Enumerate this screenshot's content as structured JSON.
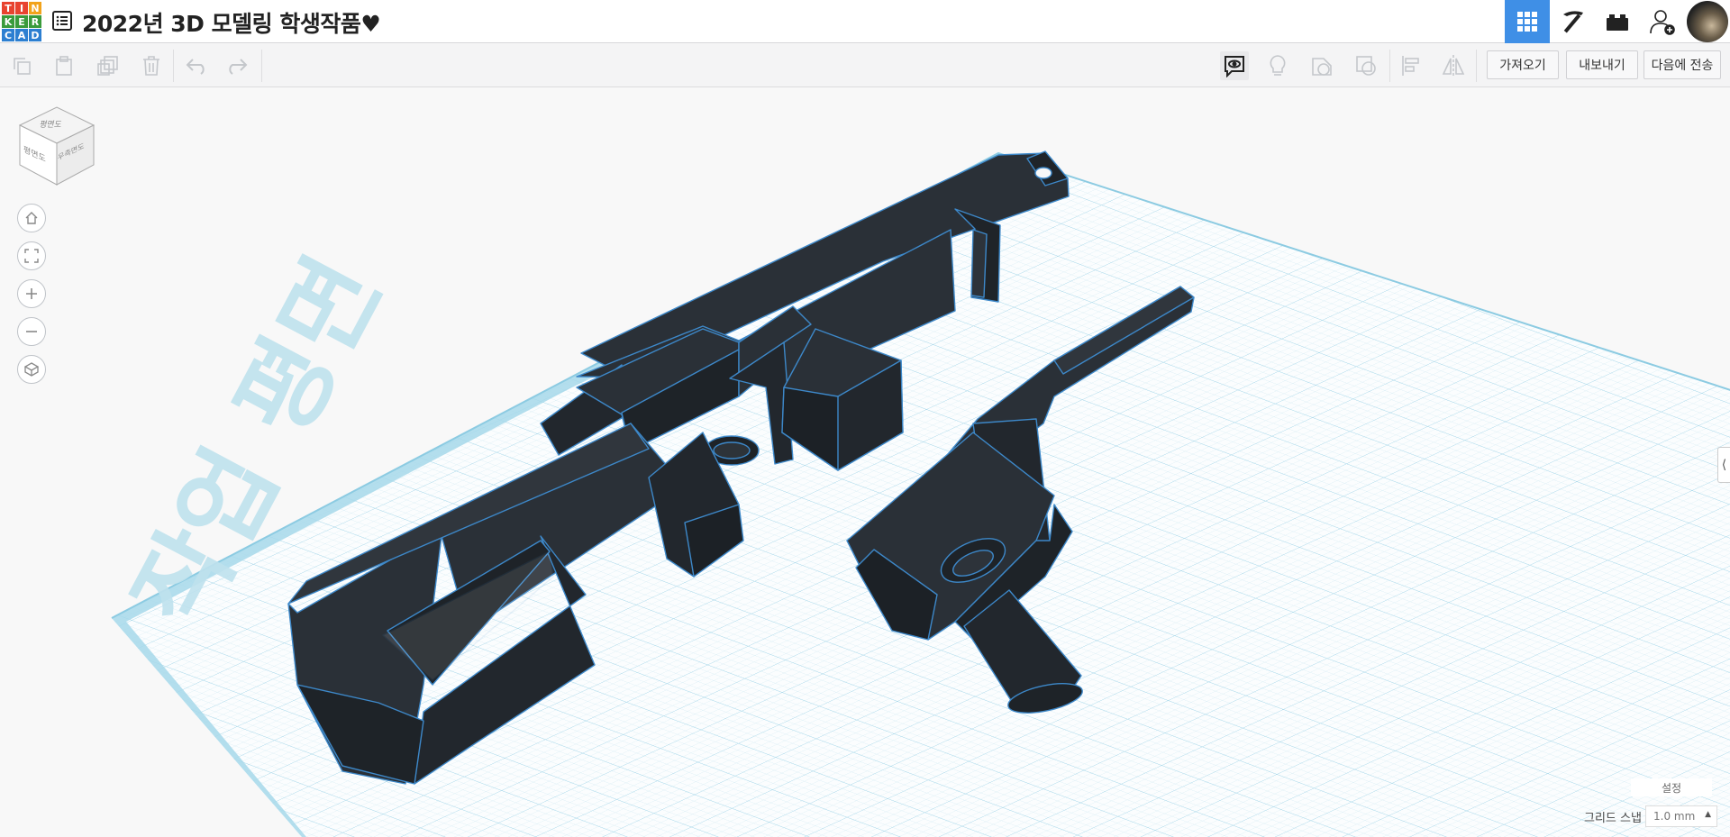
{
  "app": {
    "logo_letters": [
      "T",
      "I",
      "N",
      "K",
      "E",
      "R",
      "C",
      "A",
      "D"
    ],
    "logo_colors": [
      "#e8432f",
      "#e8432f",
      "#f2a31b",
      "#3a9b3b",
      "#3a9b3b",
      "#3a9b3b",
      "#2c7fd1",
      "#2c7fd1",
      "#2c7fd1"
    ],
    "title": "2022년 3D 모델링 학생작품♥",
    "accent": "#3f8fe6"
  },
  "header_icons": [
    "grid-view-icon",
    "pickaxe-icon",
    "bricks-icon",
    "add-user-icon",
    "profile-avatar"
  ],
  "toolbar": {
    "left_icons": [
      "copy-icon",
      "paste-icon",
      "duplicate-icon",
      "delete-icon",
      "undo-icon",
      "redo-icon"
    ],
    "right_icons": [
      "notes-icon",
      "light-bulb-icon",
      "shape-solid-icon",
      "shape-hole-icon",
      "align-icon",
      "mirror-icon"
    ],
    "import_label": "가져오기",
    "export_label": "내보내기",
    "send_to_label": "다음에 전송"
  },
  "viewcube": {
    "top_label": "평면도",
    "front_label": "평면도",
    "right_label": "우측면도"
  },
  "nav_icons": [
    "home-view-icon",
    "fit-view-icon",
    "zoom-in-icon",
    "zoom-out-icon",
    "perspective-icon"
  ],
  "workplane": {
    "watermark_text": "작업 평면",
    "grid_color": "#bfe4f0",
    "object_color": "#252a30",
    "edge_color": "#3d88c9"
  },
  "footer": {
    "settings_label": "설정",
    "snap_label": "그리드 스냅",
    "snap_value": "1.0 mm"
  },
  "side_panel_toggle": "⟨"
}
